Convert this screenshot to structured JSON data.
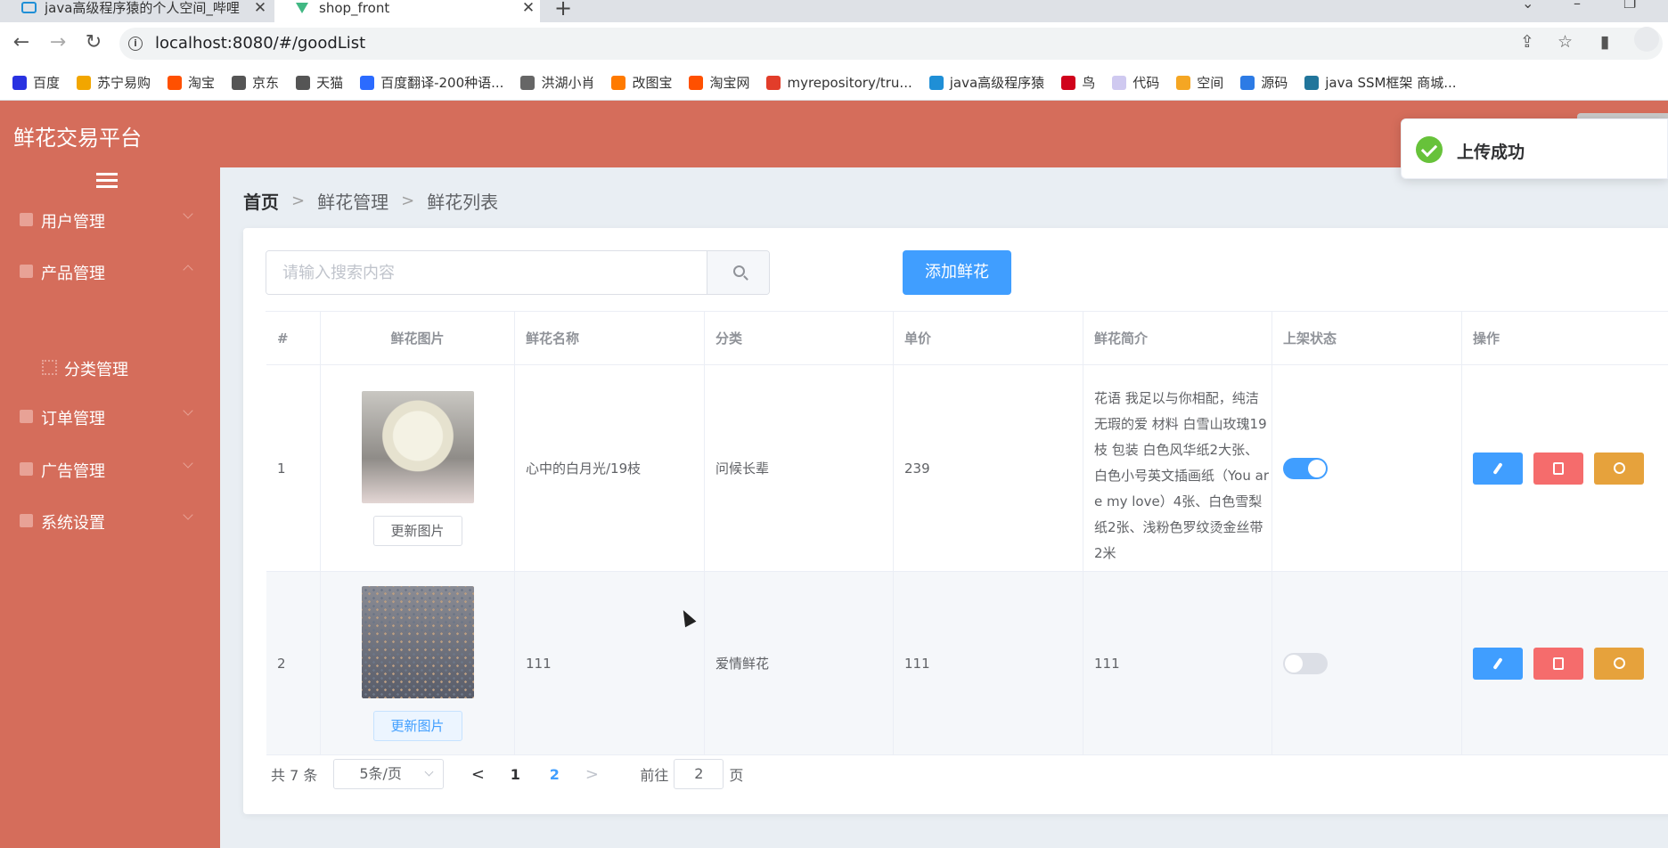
{
  "browser": {
    "tabs": [
      {
        "title": "java高级程序猿的个人空间_哔哩",
        "close": "✕"
      },
      {
        "title": "shop_front",
        "close": "✕"
      }
    ],
    "new_tab": "+",
    "url": "localhost:8080/#/goodList",
    "bookmarks": [
      {
        "label": "百度",
        "color": "#2932e1"
      },
      {
        "label": "苏宁易购",
        "color": "#f2a600"
      },
      {
        "label": "淘宝",
        "color": "#ff5000"
      },
      {
        "label": "京东",
        "color": "#555555"
      },
      {
        "label": "天猫",
        "color": "#555555"
      },
      {
        "label": "百度翻译-200种语...",
        "color": "#2b6bff"
      },
      {
        "label": "洪湖小肖",
        "color": "#666666"
      },
      {
        "label": "改图宝",
        "color": "#ff7a00"
      },
      {
        "label": "淘宝网",
        "color": "#ff5000"
      },
      {
        "label": "myrepository/tru...",
        "color": "#e23d2a"
      },
      {
        "label": "java高级程序猿",
        "color": "#1f8fd6"
      },
      {
        "label": "鸟",
        "color": "#d0021b"
      },
      {
        "label": "代码",
        "color": "#cfc9f0"
      },
      {
        "label": "空间",
        "color": "#f5a623"
      },
      {
        "label": "源码",
        "color": "#2d7be5"
      },
      {
        "label": "java SSM框架 商城...",
        "color": "#21759b"
      }
    ]
  },
  "app": {
    "brand": "鲜花交易平台",
    "sidebar": [
      {
        "label": "用户管理"
      },
      {
        "label": "产品管理"
      },
      {
        "label": "分类管理"
      },
      {
        "label": "订单管理"
      },
      {
        "label": "广告管理"
      },
      {
        "label": "系统设置"
      }
    ],
    "breadcrumb": [
      "首页",
      "鲜花管理",
      "鲜花列表"
    ],
    "breadcrumb_sep": ">",
    "search": {
      "placeholder": "请输入搜索内容"
    },
    "add_button": "添加鲜花",
    "table": {
      "headers": [
        "#",
        "鲜花图片",
        "鲜花名称",
        "分类",
        "单价",
        "鲜花简介",
        "上架状态",
        "操作"
      ],
      "update_image_label": "更新图片",
      "rows": [
        {
          "index": "1",
          "name": "心中的白月光/19枝",
          "category": "问候长辈",
          "price": "239",
          "desc": "花语 我足以与你相配，纯洁无瑕的爱 材料 白雪山玫瑰19枝 包装 白色风华纸2大张、 白色小号英文插画纸（You are my love）4张、白色雪梨纸2张、浅粉色罗纹烫金丝带2米",
          "on_sale": true
        },
        {
          "index": "2",
          "name": "111",
          "category": "爱情鲜花",
          "price": "111",
          "desc": "111",
          "on_sale": false
        }
      ]
    },
    "pagination": {
      "total": "共 7 条",
      "page_size": "5条/页",
      "pages": [
        "1",
        "2"
      ],
      "current_page": "2",
      "prev": "<",
      "next": ">",
      "goto_prefix": "前往",
      "goto_value": "2",
      "goto_suffix": "页"
    },
    "toast": {
      "message": "上传成功"
    }
  },
  "colors": {
    "primary": "#409eff",
    "sidebar": "#d56d5b",
    "danger": "#f56c6c",
    "warning": "#e6a23c",
    "success": "#67c23a"
  }
}
